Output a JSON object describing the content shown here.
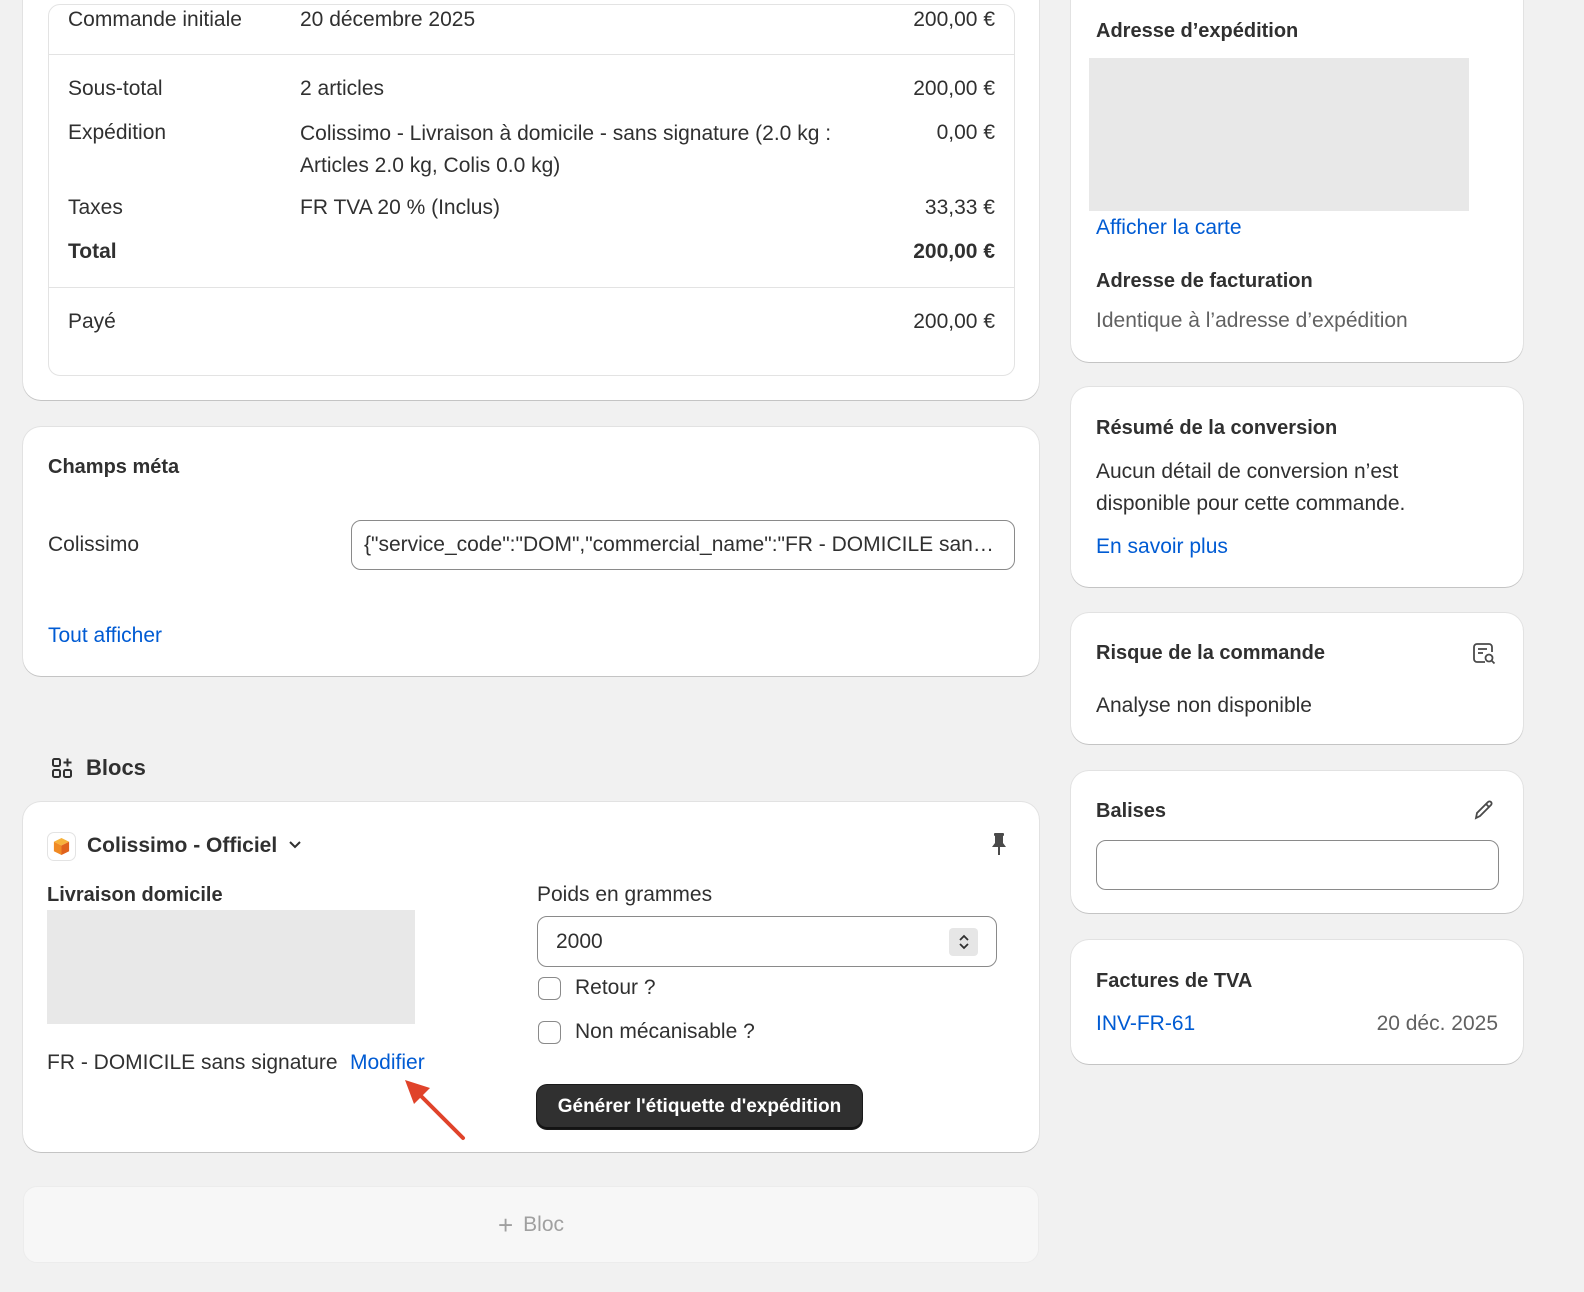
{
  "summary": {
    "initial_order_label": "Commande initiale",
    "initial_order_date": "20 décembre 2025",
    "initial_order_amount": "200,00 €",
    "subtotal_label": "Sous-total",
    "subtotal_items": "2 articles",
    "subtotal_amount": "200,00 €",
    "shipping_label": "Expédition",
    "shipping_desc": "Colissimo - Livraison à domicile - sans signature (2.0 kg : Articles 2.0 kg, Colis 0.0 kg)",
    "shipping_amount": "0,00 €",
    "taxes_label": "Taxes",
    "taxes_desc": "FR TVA 20 % (Inclus)",
    "taxes_amount": "33,33 €",
    "total_label": "Total",
    "total_amount": "200,00 €",
    "paid_label": "Payé",
    "paid_amount": "200,00 €"
  },
  "meta": {
    "title": "Champs méta",
    "field_label": "Colissimo",
    "field_value": "{\"service_code\":\"DOM\",\"commercial_name\":\"FR - DOMICILE sans signature\"}",
    "show_all": "Tout afficher"
  },
  "blocs": {
    "title": "Blocs",
    "app_name": "Colissimo - Officiel",
    "delivery_label": "Livraison domicile",
    "service_name": "FR - DOMICILE sans signature",
    "modify_link": "Modifier",
    "weight_label": "Poids en grammes",
    "weight_value": "2000",
    "return_label": "Retour ?",
    "non_mech_label": "Non mécanisable ?",
    "generate_button": "Générer l'étiquette d'expédition",
    "add_bloc": "Bloc"
  },
  "address": {
    "shipping_title": "Adresse d’expédition",
    "show_map": "Afficher la carte",
    "billing_title": "Adresse de facturation",
    "billing_value": "Identique à l’adresse d’expédition"
  },
  "conversion": {
    "title": "Résumé de la conversion",
    "text": "Aucun détail de conversion n’est disponible pour cette commande.",
    "learn_more": "En savoir plus"
  },
  "risk": {
    "title": "Risque de la commande",
    "text": "Analyse non disponible"
  },
  "tags": {
    "title": "Balises",
    "value": ""
  },
  "vat": {
    "title": "Factures de TVA",
    "invoice_id": "INV-FR-61",
    "invoice_date": "20 déc. 2025"
  },
  "colors": {
    "link": "#005bd3",
    "annotation_arrow": "#e0432a",
    "primary_button": "#303030"
  }
}
